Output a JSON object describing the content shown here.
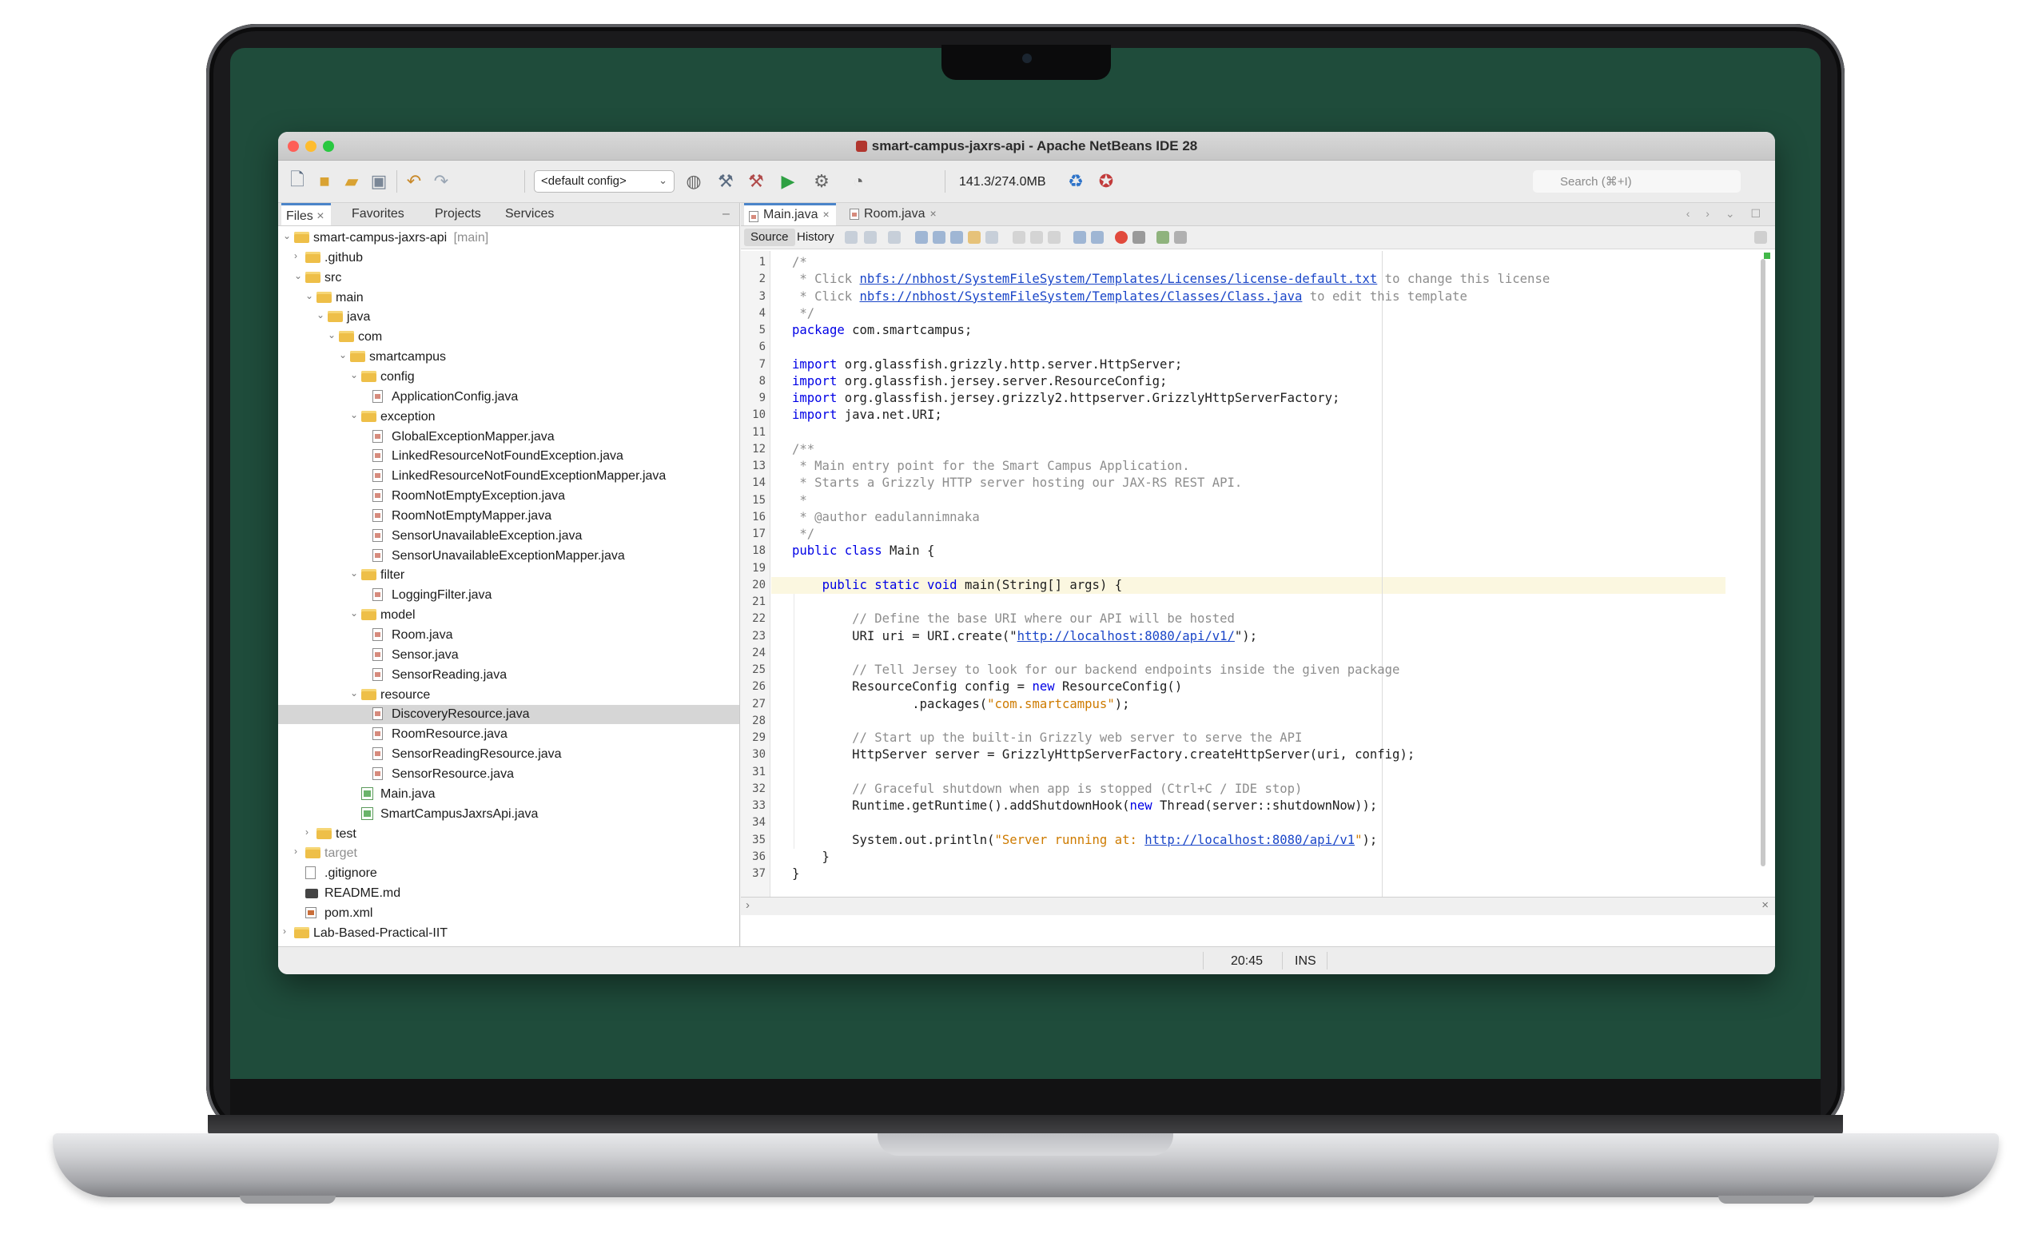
{
  "window": {
    "title": "smart-campus-jaxrs-api - Apache NetBeans IDE 28"
  },
  "toolbar": {
    "icons": [
      "new-file-icon",
      "new-project-icon",
      "open-project-icon",
      "close-project-icon",
      "undo-icon",
      "redo-icon",
      "globe-icon",
      "build-icon",
      "clean-build-icon",
      "run-icon",
      "debug-icon",
      "profile-icon"
    ],
    "config_value": "<default config>",
    "memory": "141.3/274.0MB",
    "search_placeholder": "Search (⌘+I)"
  },
  "left_panel": {
    "tabs": [
      "Files",
      "Favorites",
      "Projects",
      "Services"
    ],
    "active_tab": "Files",
    "tree": [
      {
        "label": "smart-campus-jaxrs-api",
        "suffix": "[main]",
        "depth": 0,
        "type": "folder",
        "open": true
      },
      {
        "label": ".github",
        "depth": 1,
        "type": "folder",
        "open": false
      },
      {
        "label": "src",
        "depth": 1,
        "type": "folder",
        "open": true
      },
      {
        "label": "main",
        "depth": 2,
        "type": "folder",
        "open": true
      },
      {
        "label": "java",
        "depth": 3,
        "type": "folder",
        "open": true
      },
      {
        "label": "com",
        "depth": 4,
        "type": "folder",
        "open": true
      },
      {
        "label": "smartcampus",
        "depth": 5,
        "type": "folder",
        "open": true
      },
      {
        "label": "config",
        "depth": 6,
        "type": "folder",
        "open": true
      },
      {
        "label": "ApplicationConfig.java",
        "depth": 7,
        "type": "java"
      },
      {
        "label": "exception",
        "depth": 6,
        "type": "folder",
        "open": true
      },
      {
        "label": "GlobalExceptionMapper.java",
        "depth": 7,
        "type": "java"
      },
      {
        "label": "LinkedResourceNotFoundException.java",
        "depth": 7,
        "type": "java"
      },
      {
        "label": "LinkedResourceNotFoundExceptionMapper.java",
        "depth": 7,
        "type": "java"
      },
      {
        "label": "RoomNotEmptyException.java",
        "depth": 7,
        "type": "java"
      },
      {
        "label": "RoomNotEmptyMapper.java",
        "depth": 7,
        "type": "java"
      },
      {
        "label": "SensorUnavailableException.java",
        "depth": 7,
        "type": "java"
      },
      {
        "label": "SensorUnavailableExceptionMapper.java",
        "depth": 7,
        "type": "java"
      },
      {
        "label": "filter",
        "depth": 6,
        "type": "folder",
        "open": true
      },
      {
        "label": "LoggingFilter.java",
        "depth": 7,
        "type": "java"
      },
      {
        "label": "model",
        "depth": 6,
        "type": "folder",
        "open": true
      },
      {
        "label": "Room.java",
        "depth": 7,
        "type": "java"
      },
      {
        "label": "Sensor.java",
        "depth": 7,
        "type": "java"
      },
      {
        "label": "SensorReading.java",
        "depth": 7,
        "type": "java"
      },
      {
        "label": "resource",
        "depth": 6,
        "type": "folder",
        "open": true
      },
      {
        "label": "DiscoveryResource.java",
        "depth": 7,
        "type": "java",
        "selected": true
      },
      {
        "label": "RoomResource.java",
        "depth": 7,
        "type": "java"
      },
      {
        "label": "SensorReadingResource.java",
        "depth": 7,
        "type": "java"
      },
      {
        "label": "SensorResource.java",
        "depth": 7,
        "type": "java"
      },
      {
        "label": "Main.java",
        "depth": 6,
        "type": "main"
      },
      {
        "label": "SmartCampusJaxrsApi.java",
        "depth": 6,
        "type": "main"
      },
      {
        "label": "test",
        "depth": 2,
        "type": "folder",
        "open": false
      },
      {
        "label": "target",
        "depth": 1,
        "type": "folder",
        "open": false,
        "muted": true
      },
      {
        "label": ".gitignore",
        "depth": 1,
        "type": "plain"
      },
      {
        "label": "README.md",
        "depth": 1,
        "type": "md"
      },
      {
        "label": "pom.xml",
        "depth": 1,
        "type": "xml"
      },
      {
        "label": "Lab-Based-Practical-IIT",
        "depth": 0,
        "type": "folder",
        "open": false
      }
    ]
  },
  "editor": {
    "tabs": [
      {
        "label": "Main.java",
        "active": true
      },
      {
        "label": "Room.java",
        "active": false
      }
    ],
    "subtabs": [
      "Source",
      "History"
    ],
    "active_subtab": "Source",
    "highlight_line": 20,
    "lines": [
      [
        [
          "cm",
          "/*"
        ]
      ],
      [
        [
          "cm",
          " * Click "
        ],
        [
          "lnk",
          "nbfs://nbhost/SystemFileSystem/Templates/Licenses/license-default.txt"
        ],
        [
          "cm",
          " to change this license"
        ]
      ],
      [
        [
          "cm",
          " * Click "
        ],
        [
          "lnk",
          "nbfs://nbhost/SystemFileSystem/Templates/Classes/Class.java"
        ],
        [
          "cm",
          " to edit this template"
        ]
      ],
      [
        [
          "cm",
          " */"
        ]
      ],
      [
        [
          "kw",
          "package"
        ],
        [
          "t",
          " com.smartcampus;"
        ]
      ],
      [],
      [
        [
          "kw",
          "import"
        ],
        [
          "t",
          " org.glassfish.grizzly.http.server.HttpServer;"
        ]
      ],
      [
        [
          "kw",
          "import"
        ],
        [
          "t",
          " org.glassfish.jersey.server.ResourceConfig;"
        ]
      ],
      [
        [
          "kw",
          "import"
        ],
        [
          "t",
          " org.glassfish.jersey.grizzly2.httpserver.GrizzlyHttpServerFactory;"
        ]
      ],
      [
        [
          "kw",
          "import"
        ],
        [
          "t",
          " java.net.URI;"
        ]
      ],
      [],
      [
        [
          "cm",
          "/**"
        ]
      ],
      [
        [
          "cm",
          " * Main entry point for the Smart Campus Application."
        ]
      ],
      [
        [
          "cm",
          " * Starts a Grizzly HTTP server hosting our JAX-RS REST API."
        ]
      ],
      [
        [
          "cm",
          " *"
        ]
      ],
      [
        [
          "cm",
          " * @author eadulannimnaka"
        ]
      ],
      [
        [
          "cm",
          " */"
        ]
      ],
      [
        [
          "kw",
          "public class"
        ],
        [
          "t",
          " Main {"
        ]
      ],
      [],
      [
        [
          "t",
          "    "
        ],
        [
          "kw",
          "public static void"
        ],
        [
          "t",
          " main(String[] args) {"
        ]
      ],
      [],
      [
        [
          "cm",
          "        // Define the base URI where our API will be hosted"
        ]
      ],
      [
        [
          "t",
          "        URI uri = URI.create(\""
        ],
        [
          "lnk",
          "http://localhost:8080/api/v1/"
        ],
        [
          "t",
          "\");"
        ]
      ],
      [],
      [
        [
          "cm",
          "        // Tell Jersey to look for our backend endpoints inside the given package"
        ]
      ],
      [
        [
          "t",
          "        ResourceConfig config = "
        ],
        [
          "kw",
          "new"
        ],
        [
          "t",
          " ResourceConfig()"
        ]
      ],
      [
        [
          "t",
          "                .packages("
        ],
        [
          "str",
          "\"com.smartcampus\""
        ],
        [
          "t",
          ");"
        ]
      ],
      [],
      [
        [
          "cm",
          "        // Start up the built-in Grizzly web server to serve the API"
        ]
      ],
      [
        [
          "t",
          "        HttpServer server = GrizzlyHttpServerFactory.createHttpServer(uri, config);"
        ]
      ],
      [],
      [
        [
          "cm",
          "        // Graceful shutdown when app is stopped (Ctrl+C / IDE stop)"
        ]
      ],
      [
        [
          "t",
          "        Runtime.getRuntime().addShutdownHook("
        ],
        [
          "kw",
          "new"
        ],
        [
          "t",
          " Thread(server::shutdownNow));"
        ]
      ],
      [],
      [
        [
          "t",
          "        System.out.println("
        ],
        [
          "str",
          "\"Server running at: "
        ],
        [
          "lnk",
          "http://localhost:8080/api/v1"
        ],
        [
          "str",
          "\""
        ],
        [
          "t",
          ");"
        ]
      ],
      [
        [
          "t",
          "    }"
        ]
      ],
      [
        [
          "t",
          "}"
        ]
      ]
    ]
  },
  "status": {
    "position": "20:45",
    "mode": "INS"
  }
}
